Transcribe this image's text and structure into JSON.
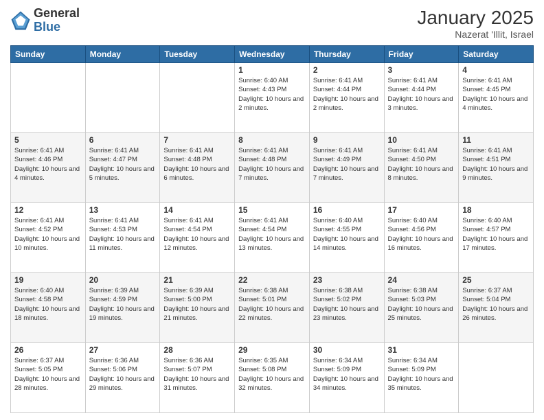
{
  "header": {
    "logo_general": "General",
    "logo_blue": "Blue",
    "month_title": "January 2025",
    "location": "Nazerat 'Illit, Israel"
  },
  "weekdays": [
    "Sunday",
    "Monday",
    "Tuesday",
    "Wednesday",
    "Thursday",
    "Friday",
    "Saturday"
  ],
  "weeks": [
    [
      {
        "day": "",
        "info": ""
      },
      {
        "day": "",
        "info": ""
      },
      {
        "day": "",
        "info": ""
      },
      {
        "day": "1",
        "info": "Sunrise: 6:40 AM\nSunset: 4:43 PM\nDaylight: 10 hours\nand 2 minutes."
      },
      {
        "day": "2",
        "info": "Sunrise: 6:41 AM\nSunset: 4:44 PM\nDaylight: 10 hours\nand 2 minutes."
      },
      {
        "day": "3",
        "info": "Sunrise: 6:41 AM\nSunset: 4:44 PM\nDaylight: 10 hours\nand 3 minutes."
      },
      {
        "day": "4",
        "info": "Sunrise: 6:41 AM\nSunset: 4:45 PM\nDaylight: 10 hours\nand 4 minutes."
      }
    ],
    [
      {
        "day": "5",
        "info": "Sunrise: 6:41 AM\nSunset: 4:46 PM\nDaylight: 10 hours\nand 4 minutes."
      },
      {
        "day": "6",
        "info": "Sunrise: 6:41 AM\nSunset: 4:47 PM\nDaylight: 10 hours\nand 5 minutes."
      },
      {
        "day": "7",
        "info": "Sunrise: 6:41 AM\nSunset: 4:48 PM\nDaylight: 10 hours\nand 6 minutes."
      },
      {
        "day": "8",
        "info": "Sunrise: 6:41 AM\nSunset: 4:48 PM\nDaylight: 10 hours\nand 7 minutes."
      },
      {
        "day": "9",
        "info": "Sunrise: 6:41 AM\nSunset: 4:49 PM\nDaylight: 10 hours\nand 7 minutes."
      },
      {
        "day": "10",
        "info": "Sunrise: 6:41 AM\nSunset: 4:50 PM\nDaylight: 10 hours\nand 8 minutes."
      },
      {
        "day": "11",
        "info": "Sunrise: 6:41 AM\nSunset: 4:51 PM\nDaylight: 10 hours\nand 9 minutes."
      }
    ],
    [
      {
        "day": "12",
        "info": "Sunrise: 6:41 AM\nSunset: 4:52 PM\nDaylight: 10 hours\nand 10 minutes."
      },
      {
        "day": "13",
        "info": "Sunrise: 6:41 AM\nSunset: 4:53 PM\nDaylight: 10 hours\nand 11 minutes."
      },
      {
        "day": "14",
        "info": "Sunrise: 6:41 AM\nSunset: 4:54 PM\nDaylight: 10 hours\nand 12 minutes."
      },
      {
        "day": "15",
        "info": "Sunrise: 6:41 AM\nSunset: 4:54 PM\nDaylight: 10 hours\nand 13 minutes."
      },
      {
        "day": "16",
        "info": "Sunrise: 6:40 AM\nSunset: 4:55 PM\nDaylight: 10 hours\nand 14 minutes."
      },
      {
        "day": "17",
        "info": "Sunrise: 6:40 AM\nSunset: 4:56 PM\nDaylight: 10 hours\nand 16 minutes."
      },
      {
        "day": "18",
        "info": "Sunrise: 6:40 AM\nSunset: 4:57 PM\nDaylight: 10 hours\nand 17 minutes."
      }
    ],
    [
      {
        "day": "19",
        "info": "Sunrise: 6:40 AM\nSunset: 4:58 PM\nDaylight: 10 hours\nand 18 minutes."
      },
      {
        "day": "20",
        "info": "Sunrise: 6:39 AM\nSunset: 4:59 PM\nDaylight: 10 hours\nand 19 minutes."
      },
      {
        "day": "21",
        "info": "Sunrise: 6:39 AM\nSunset: 5:00 PM\nDaylight: 10 hours\nand 21 minutes."
      },
      {
        "day": "22",
        "info": "Sunrise: 6:38 AM\nSunset: 5:01 PM\nDaylight: 10 hours\nand 22 minutes."
      },
      {
        "day": "23",
        "info": "Sunrise: 6:38 AM\nSunset: 5:02 PM\nDaylight: 10 hours\nand 23 minutes."
      },
      {
        "day": "24",
        "info": "Sunrise: 6:38 AM\nSunset: 5:03 PM\nDaylight: 10 hours\nand 25 minutes."
      },
      {
        "day": "25",
        "info": "Sunrise: 6:37 AM\nSunset: 5:04 PM\nDaylight: 10 hours\nand 26 minutes."
      }
    ],
    [
      {
        "day": "26",
        "info": "Sunrise: 6:37 AM\nSunset: 5:05 PM\nDaylight: 10 hours\nand 28 minutes."
      },
      {
        "day": "27",
        "info": "Sunrise: 6:36 AM\nSunset: 5:06 PM\nDaylight: 10 hours\nand 29 minutes."
      },
      {
        "day": "28",
        "info": "Sunrise: 6:36 AM\nSunset: 5:07 PM\nDaylight: 10 hours\nand 31 minutes."
      },
      {
        "day": "29",
        "info": "Sunrise: 6:35 AM\nSunset: 5:08 PM\nDaylight: 10 hours\nand 32 minutes."
      },
      {
        "day": "30",
        "info": "Sunrise: 6:34 AM\nSunset: 5:09 PM\nDaylight: 10 hours\nand 34 minutes."
      },
      {
        "day": "31",
        "info": "Sunrise: 6:34 AM\nSunset: 5:09 PM\nDaylight: 10 hours\nand 35 minutes."
      },
      {
        "day": "",
        "info": ""
      }
    ]
  ]
}
